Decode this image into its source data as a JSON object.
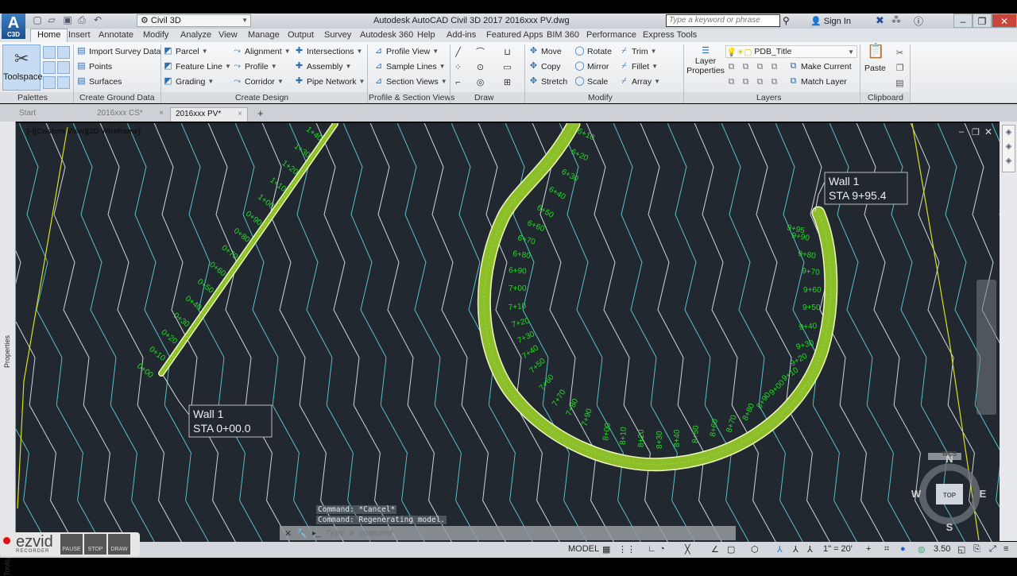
{
  "app": {
    "title": "Autodesk AutoCAD Civil 3D 2017    2016xxx PV.dwg",
    "app_button_label": "A",
    "app_button_sub": "C3D",
    "workspace": "Civil 3D",
    "search_placeholder": "Type a keyword or phrase",
    "sign_in": "Sign In"
  },
  "ribbon_tabs": [
    "Home",
    "Insert",
    "Annotate",
    "Modify",
    "Analyze",
    "View",
    "Manage",
    "Output",
    "Survey",
    "Autodesk 360",
    "Help",
    "Add-ins",
    "Featured Apps",
    "BIM 360",
    "Performance",
    "Express Tools"
  ],
  "ribbon": {
    "toolspace": "Toolspace",
    "ground": [
      "Import Survey Data",
      "Points",
      "Surfaces"
    ],
    "design_col1": [
      "Parcel",
      "Feature Line",
      "Grading"
    ],
    "design_col2": [
      "Alignment",
      "Profile",
      "Corridor"
    ],
    "design_col3": [
      "Intersections",
      "Assembly",
      "Pipe Network"
    ],
    "profile": [
      "Profile View",
      "Sample Lines",
      "Section Views"
    ],
    "modify_col1": [
      "Move",
      "Copy",
      "Stretch"
    ],
    "modify_col2": [
      "Rotate",
      "Mirror",
      "Scale"
    ],
    "modify_col3": [
      "Trim",
      "Fillet",
      "Array"
    ],
    "layer_properties": "Layer Properties",
    "current_layer": "PDB_Title",
    "make_current": "Make Current",
    "match_layer": "Match Layer",
    "paste": "Paste",
    "panels": [
      "Palettes",
      "Create Ground Data",
      "Create Design",
      "Profile & Section Views",
      "Draw",
      "Modify",
      "Layers",
      "Clipboard"
    ]
  },
  "file_tabs": [
    "Start",
    "2016xxx CS*",
    "2016xxx PV*"
  ],
  "side_palettes": [
    "Properties",
    "Toolspace"
  ],
  "viewport": {
    "label": "[-][Custom View][2D Wireframe]",
    "callouts": [
      {
        "line1": "Wall 1",
        "line2": "STA 0+00.0"
      },
      {
        "line1": "Wall 1",
        "line2": "STA 9+95.4"
      }
    ],
    "stations_left": [
      "0+00",
      "0+10",
      "0+20",
      "0+30",
      "0+40",
      "0+50",
      "0+60",
      "0+70",
      "0+80",
      "0+90",
      "1+00",
      "1+10",
      "1+20",
      "1+30",
      "1+40"
    ],
    "stations_curve": [
      "6+10",
      "6+20",
      "6+30",
      "6+40",
      "6+50",
      "6+60",
      "6+70",
      "6+80",
      "6+90",
      "7+00",
      "7+10",
      "7+20",
      "7+30",
      "7+40",
      "7+50",
      "7+60",
      "7+70",
      "7+80",
      "7+90",
      "8+00",
      "8+10",
      "8+20",
      "8+30",
      "8+40",
      "8+50",
      "8+60",
      "8+70",
      "8+80",
      "8+90",
      "9+00",
      "9+10",
      "9+20",
      "9+30",
      "9+40",
      "9+50",
      "9+60",
      "9+70",
      "9+80",
      "9+90",
      "9+95"
    ],
    "compass": {
      "n": "N",
      "s": "S",
      "e": "E",
      "w": "W",
      "top": "TOP",
      "wcs": "WCS"
    }
  },
  "command": {
    "history": [
      "Command: *Cancel*",
      "Command:  Regenerating model."
    ],
    "placeholder": "Type a command"
  },
  "status": {
    "model": "MODEL",
    "scale": "1\" = 20'",
    "annotation_value": "3.50"
  },
  "recorder": {
    "brand": "ezvid",
    "sub": "RECORDER",
    "buttons": [
      "PAUSE",
      "STOP",
      "DRAW"
    ]
  },
  "colors": {
    "canvas": "#212830",
    "wall": "#8cbf2a",
    "station_text": "#22dd22",
    "contour_a": "#dfe9ec",
    "contour_b": "#5fd0d8",
    "boundary": "#d8e020"
  }
}
